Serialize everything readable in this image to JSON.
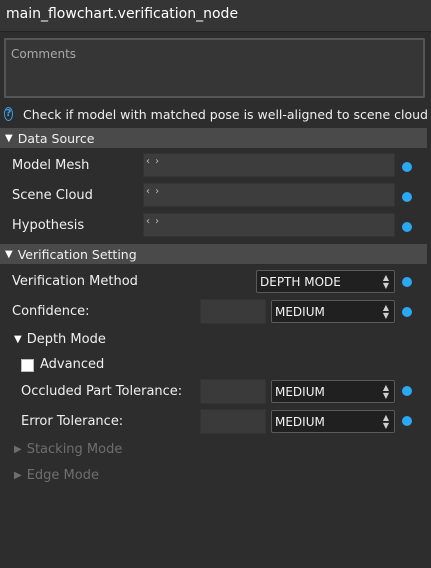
{
  "window": {
    "title": "main_flowchart.verification_node"
  },
  "comments": {
    "placeholder": "Comments"
  },
  "help": {
    "icon": "?",
    "text": "Check if model with matched pose is well-aligned to scene cloud"
  },
  "data_source": {
    "header": "Data Source",
    "rows": [
      {
        "label": "Model Mesh",
        "value": "‹ ›"
      },
      {
        "label": "Scene Cloud",
        "value": "‹ ›"
      },
      {
        "label": "Hypothesis",
        "value": "‹ ›"
      }
    ]
  },
  "verification": {
    "header": "Verification Setting",
    "method": {
      "label": "Verification Method",
      "value": "DEPTH MODE"
    },
    "confidence": {
      "label": "Confidence:",
      "value": "MEDIUM"
    },
    "depth_mode": {
      "header": "Depth Mode",
      "advanced_label": "Advanced",
      "occluded": {
        "label": "Occluded Part Tolerance:",
        "value": "MEDIUM"
      },
      "error": {
        "label": "Error Tolerance:",
        "value": "MEDIUM"
      }
    },
    "stacking_mode": "Stacking Mode",
    "edge_mode": "Edge Mode"
  },
  "colors": {
    "accent": "#2aa8f2",
    "background": "#2d2d2d",
    "section": "#4a4a4a"
  }
}
